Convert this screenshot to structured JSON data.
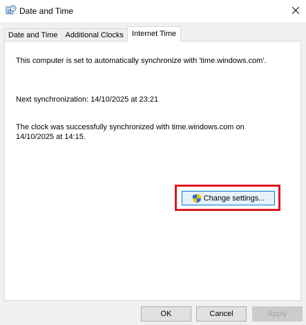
{
  "window": {
    "title": "Date and Time"
  },
  "tabs": [
    {
      "label": "Date and Time",
      "active": false
    },
    {
      "label": "Additional Clocks",
      "active": false
    },
    {
      "label": "Internet Time",
      "active": true
    }
  ],
  "panel": {
    "sync_message": "This computer is set to automatically synchronize with 'time.windows.com'.",
    "next_sync": "Next synchronization: 14/10/2025 at 23:21",
    "last_sync_line1": "The clock was successfully synchronized with time.windows.com on",
    "last_sync_line2": "14/10/2025 at 14:15.",
    "change_settings_label": "Change settings..."
  },
  "buttons": {
    "ok": "OK",
    "cancel": "Cancel",
    "apply": "Apply"
  },
  "colors": {
    "highlight": "#e0141e",
    "focus_border": "#0078d7"
  },
  "icons": {
    "window": "clock-globe-icon",
    "close": "close-icon",
    "uac": "uac-shield-icon"
  }
}
